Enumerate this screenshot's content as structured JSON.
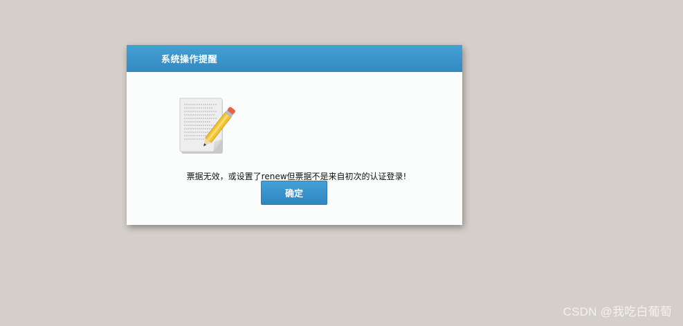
{
  "dialog": {
    "title": "系统操作提醒",
    "icon": "document-pencil-icon",
    "message": "票据无效，或设置了renew但票据不是来自初次的认证登录!",
    "confirm_label": "确定"
  },
  "watermark": {
    "text": "CSDN @我吃白葡萄"
  },
  "colors": {
    "background": "#d4cfc9",
    "header": "#3d94cc",
    "button": "#3a94cb",
    "dialog_body": "#fbfdfd"
  }
}
